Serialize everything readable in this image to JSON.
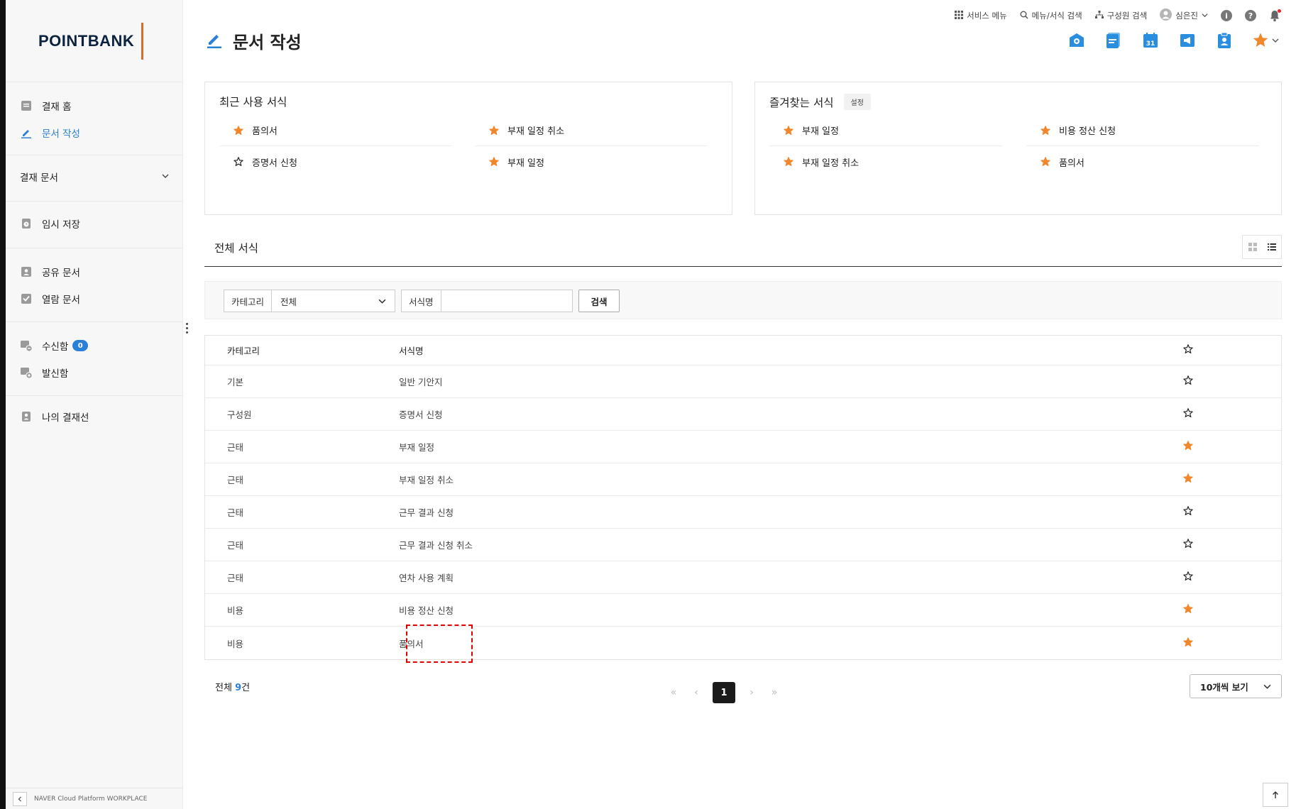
{
  "logo": "POINTBANK",
  "page": {
    "title": "문서 작성"
  },
  "topbar": {
    "service_menu": "서비스 메뉴",
    "menu_search": "메뉴/서식 검색",
    "member_search": "구성원 검색",
    "user_name": "심은진"
  },
  "sidebar": {
    "items": [
      {
        "label": "결재 홈",
        "icon": "doc-home-icon"
      },
      {
        "label": "문서 작성",
        "icon": "pencil-icon",
        "active": true
      }
    ],
    "section": "결재 문서",
    "temp_save": "임시 저장",
    "shared_docs": "공유 문서",
    "viewed_docs": "열람 문서",
    "inbox": "수신함",
    "inbox_count": "0",
    "outbox": "발신함",
    "my_approval_line": "나의 결재선",
    "footer": "NAVER Cloud Platform WORKPLACE"
  },
  "recent": {
    "title": "최근 사용 서식",
    "items": [
      {
        "label": "품의서",
        "starred": true
      },
      {
        "label": "부재 일정 취소",
        "starred": true
      },
      {
        "label": "증명서 신청",
        "starred": false
      },
      {
        "label": "부재 일정",
        "starred": true
      }
    ]
  },
  "favorites": {
    "title": "즐겨찾는 서식",
    "settings_label": "설정",
    "items": [
      {
        "label": "부재 일정",
        "starred": true
      },
      {
        "label": "비용 정산 신청",
        "starred": true
      },
      {
        "label": "부재 일정 취소",
        "starred": true
      },
      {
        "label": "품의서",
        "starred": true
      }
    ]
  },
  "all_forms": {
    "title": "전체 서식",
    "filter": {
      "category_label": "카테고리",
      "category_value": "전체",
      "name_label": "서식명",
      "name_value": "",
      "search_button": "검색"
    },
    "columns": {
      "category": "카테고리",
      "name": "서식명"
    },
    "rows": [
      {
        "category": "기본",
        "name": "일반 기안지",
        "starred": false
      },
      {
        "category": "구성원",
        "name": "증명서 신청",
        "starred": false
      },
      {
        "category": "근태",
        "name": "부재 일정",
        "starred": true
      },
      {
        "category": "근태",
        "name": "부재 일정 취소",
        "starred": true
      },
      {
        "category": "근태",
        "name": "근무 결과 신청",
        "starred": false
      },
      {
        "category": "근태",
        "name": "근무 결과 신청 취소",
        "starred": false
      },
      {
        "category": "근태",
        "name": "연차 사용 계획",
        "starred": false
      },
      {
        "category": "비용",
        "name": "비용 정산 신청",
        "starred": true
      },
      {
        "category": "비용",
        "name": "품의서",
        "starred": true
      }
    ],
    "total_prefix": "전체 ",
    "total_count": "9",
    "total_suffix": "건",
    "current_page": "1",
    "per_page": "10개씩 보기"
  },
  "colors": {
    "accent": "#2a7fd6",
    "star": "#f0872d",
    "logo_bar": "#e2672a",
    "highlight": "#e00000"
  }
}
